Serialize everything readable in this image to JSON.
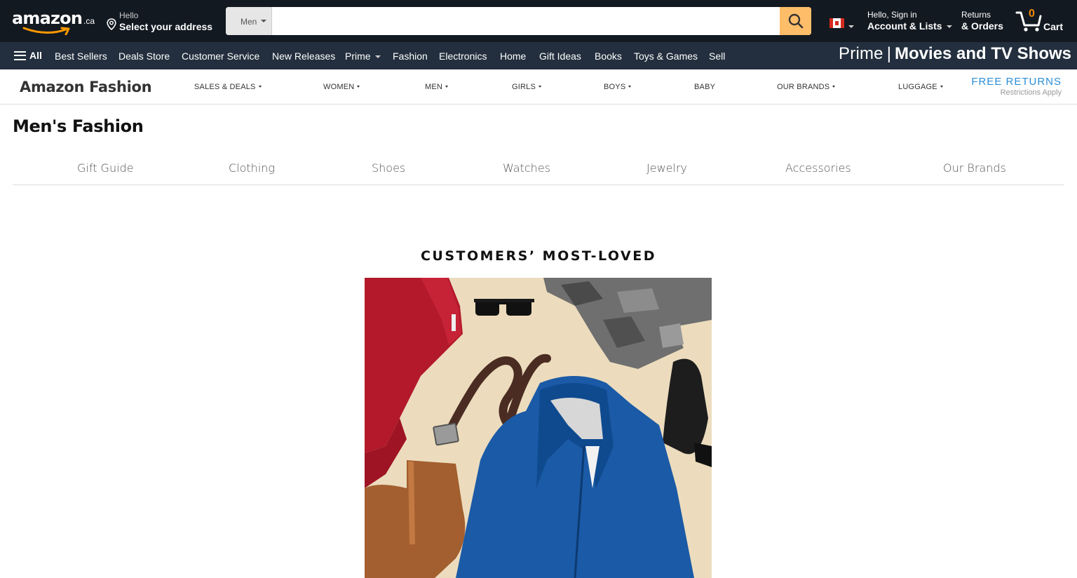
{
  "header": {
    "logo_text": "amazon",
    "logo_tld": ".ca",
    "address_hello": "Hello",
    "address_label": "Select your address",
    "search_dept": "Men",
    "search_placeholder": "",
    "account_line1": "Hello, Sign in",
    "account_line2": "Account & Lists",
    "returns_line1": "Returns",
    "returns_line2": "& Orders",
    "cart_count": "0",
    "cart_label": "Cart"
  },
  "subnav": {
    "all_label": "All",
    "items": [
      "Best Sellers",
      "Deals Store",
      "Customer Service",
      "New Releases",
      "Prime",
      "Fashion",
      "Electronics",
      "Home",
      "Gift Ideas",
      "Books",
      "Toys & Games",
      "Sell"
    ],
    "promo_prime": "Prime",
    "promo_separator": "|",
    "promo_text": "Movies and TV Shows"
  },
  "fashion_nav": {
    "title": "Amazon Fashion",
    "items": [
      "SALES & DEALS",
      "WOMEN",
      "MEN",
      "GIRLS",
      "BOYS",
      "BABY",
      "OUR BRANDS",
      "LUGGAGE"
    ],
    "free_returns": "FREE RETURNS",
    "restrictions": "Restrictions Apply"
  },
  "page": {
    "title": "Men's Fashion",
    "categories": [
      "Gift Guide",
      "Clothing",
      "Shoes",
      "Watches",
      "Jewelry",
      "Accessories",
      "Our Brands"
    ],
    "section_title": "CUSTOMERS’ MOST-LOVED"
  },
  "colors": {
    "topnav_bg": "#131921",
    "subnav_bg": "#232f3e",
    "search_button": "#febd69",
    "cart_count": "#f08804",
    "free_returns": "#2b8fd6"
  }
}
